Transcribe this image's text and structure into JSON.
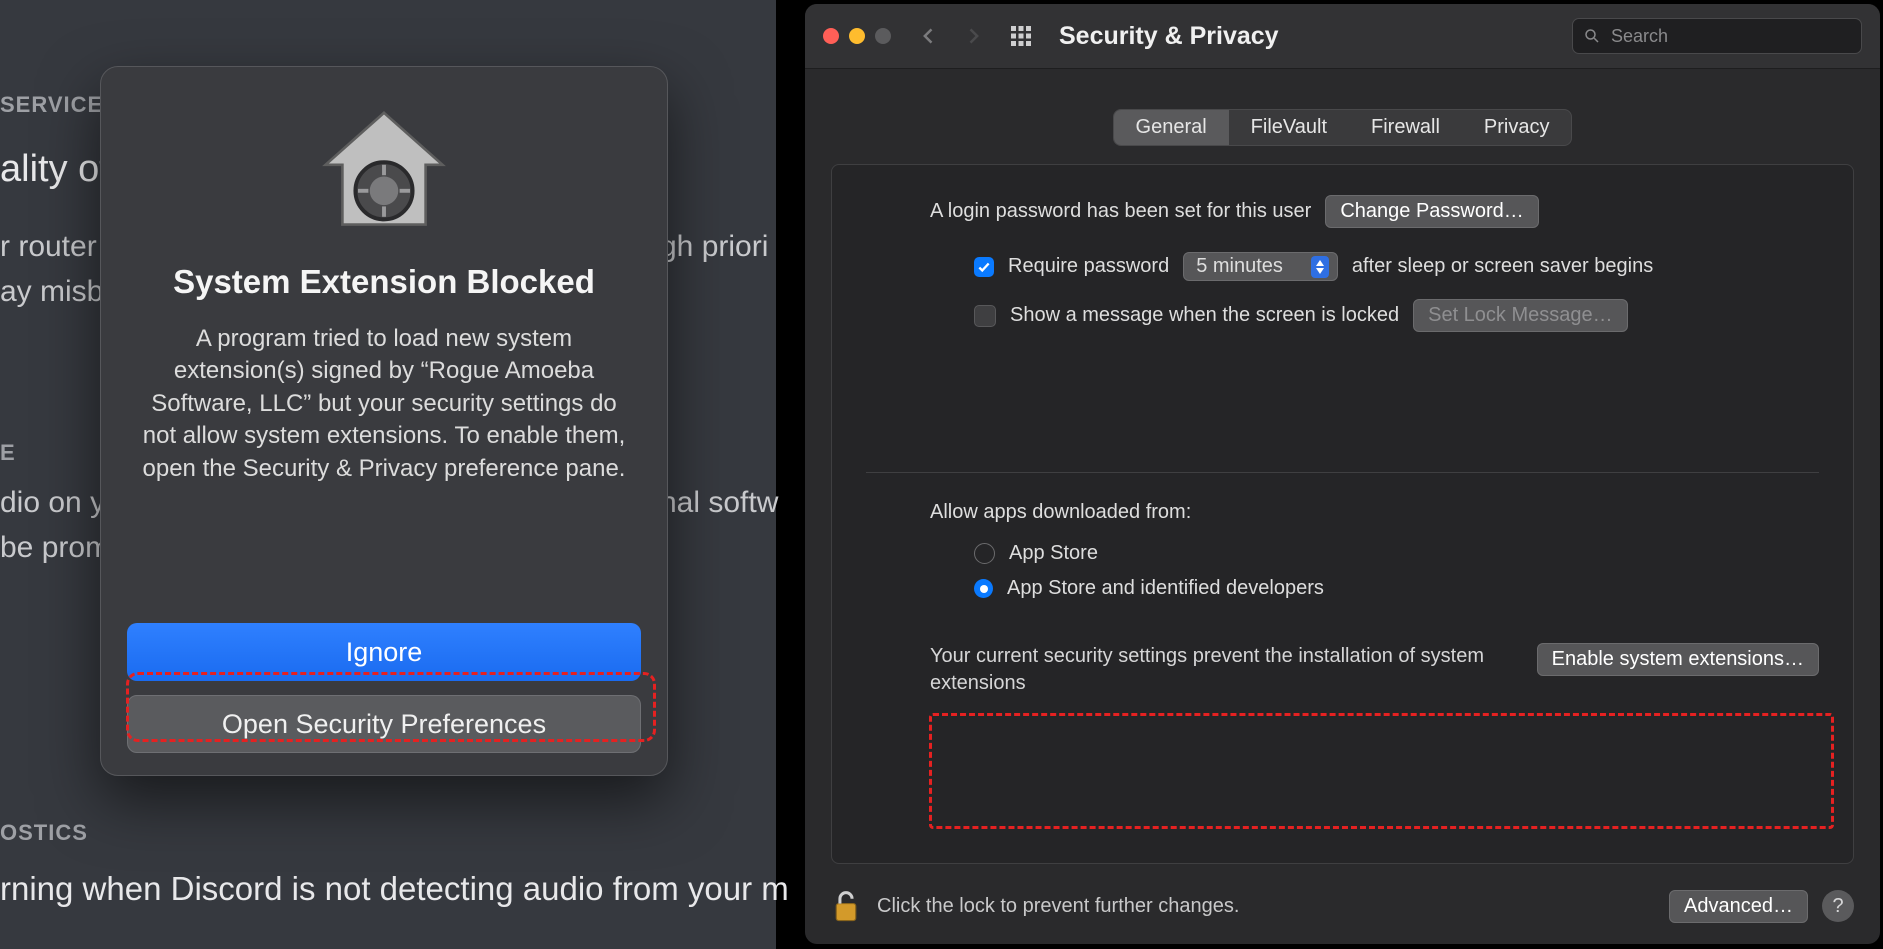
{
  "background": {
    "service": "SERVICE",
    "quality": "ality of S",
    "router": "r router t",
    "misbe": "ay misbe",
    "gh": "gh priori",
    "e_heading": "E",
    "dio": "dio on y",
    "nal": "nal softw",
    "beprom": "be prom",
    "ostics": "OSTICS",
    "warning": "rning when Discord is not detecting audio from your m"
  },
  "dialog": {
    "title": "System Extension Blocked",
    "body": "A program tried to load new system extension(s) signed by “Rogue Amoeba Software, LLC” but your security settings do not allow system extensions. To enable them, open the Security & Privacy preference pane.",
    "ignore": "Ignore",
    "open_prefs": "Open Security Preferences"
  },
  "prefs": {
    "title": "Security & Privacy",
    "search_placeholder": "Search",
    "tabs": {
      "general": "General",
      "filevault": "FileVault",
      "firewall": "Firewall",
      "privacy": "Privacy"
    },
    "login_set": "A login password has been set for this user",
    "change_password": "Change Password…",
    "require_password": "Require password",
    "require_delay": "5 minutes",
    "after_sleep": "after sleep or screen saver begins",
    "show_message": "Show a message when the screen is locked",
    "set_lock_message": "Set Lock Message…",
    "allow_heading": "Allow apps downloaded from:",
    "allow_appstore": "App Store",
    "allow_appstore_dev": "App Store and identified developers",
    "sysext_text": "Your current security settings prevent the installation of system extensions",
    "enable_sysext": "Enable system extensions…",
    "lock_text": "Click the lock to prevent further changes.",
    "advanced": "Advanced…",
    "help": "?"
  }
}
